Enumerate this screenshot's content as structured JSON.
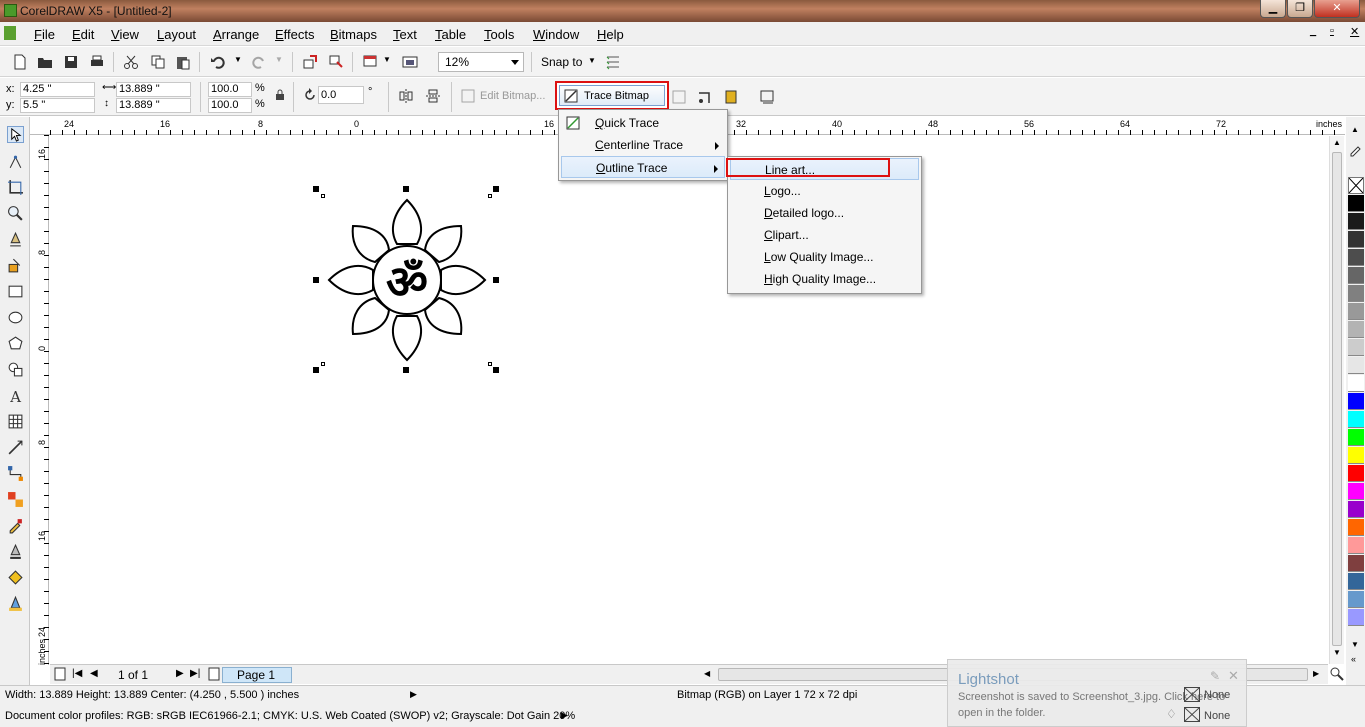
{
  "window": {
    "title": "CorelDRAW X5 - [Untitled-2]",
    "min_glyph": "▁",
    "max_glyph": "❐",
    "close_glyph": "✕"
  },
  "menubar": [
    "File",
    "Edit",
    "View",
    "Layout",
    "Arrange",
    "Effects",
    "Bitmaps",
    "Text",
    "Table",
    "Tools",
    "Window",
    "Help"
  ],
  "doc_controls": {
    "min": "_",
    "max": "▫",
    "close": "✕"
  },
  "toolbar": {
    "zoom": "12%",
    "snap_to": "Snap to"
  },
  "propbar": {
    "x_label": "x:",
    "x": "4.25 \"",
    "y_label": "y:",
    "y": "5.5 \"",
    "width": "13.889 \"",
    "height": "13.889 \"",
    "scale_w": "100.0",
    "scale_h": "100.0",
    "pct": "%",
    "angle": "0.0",
    "deg": "°",
    "edit_bitmap": "Edit Bitmap...",
    "trace_bitmap": "Trace Bitmap"
  },
  "ruler_top": [
    "24",
    "16",
    "8",
    "0",
    "16",
    "32",
    "40",
    "48",
    "56",
    "64",
    "72"
  ],
  "ruler_top_unit": "inches",
  "ruler_left": [
    "16",
    "8",
    "0",
    "8",
    "16",
    "24"
  ],
  "ruler_left_unit": "inches",
  "trace_menu": [
    {
      "label": "Quick Trace",
      "submenu": false
    },
    {
      "label": "Centerline Trace",
      "submenu": true
    },
    {
      "label": "Outline Trace",
      "submenu": true
    }
  ],
  "outline_menu": [
    "Line art...",
    "Logo...",
    "Detailed logo...",
    "Clipart...",
    "Low Quality Image...",
    "High Quality Image..."
  ],
  "palette_colors": [
    "#000000",
    "#1a1a1a",
    "#333333",
    "#4d4d4d",
    "#666666",
    "#808080",
    "#999999",
    "#b3b3b3",
    "#cccccc",
    "#e6e6e6",
    "#ffffff",
    "#0000ff",
    "#00ffff",
    "#00ff00",
    "#ffff00",
    "#ff0000",
    "#ff00ff",
    "#9900cc",
    "#ff6600",
    "#ff9999",
    "#7f3f3f",
    "#336699",
    "#6699cc",
    "#9999ff"
  ],
  "page_nav": {
    "counter": "1 of 1",
    "page_tab": "Page 1"
  },
  "status": {
    "line1": "Width: 13.889  Height: 13.889  Center: (4.250 , 5.500 )  inches",
    "object": "Bitmap (RGB) on Layer 1 72 x 72 dpi",
    "line2": "Document color profiles: RGB: sRGB IEC61966-2.1; CMYK: U.S. Web Coated (SWOP) v2; Grayscale: Dot Gain 20%"
  },
  "lightshot": {
    "title": "Lightshot",
    "msg1": "Screenshot is saved to Screenshot_3.jpg. Click here to",
    "msg2": "open in the folder.",
    "none1": "None",
    "none2": "None"
  }
}
